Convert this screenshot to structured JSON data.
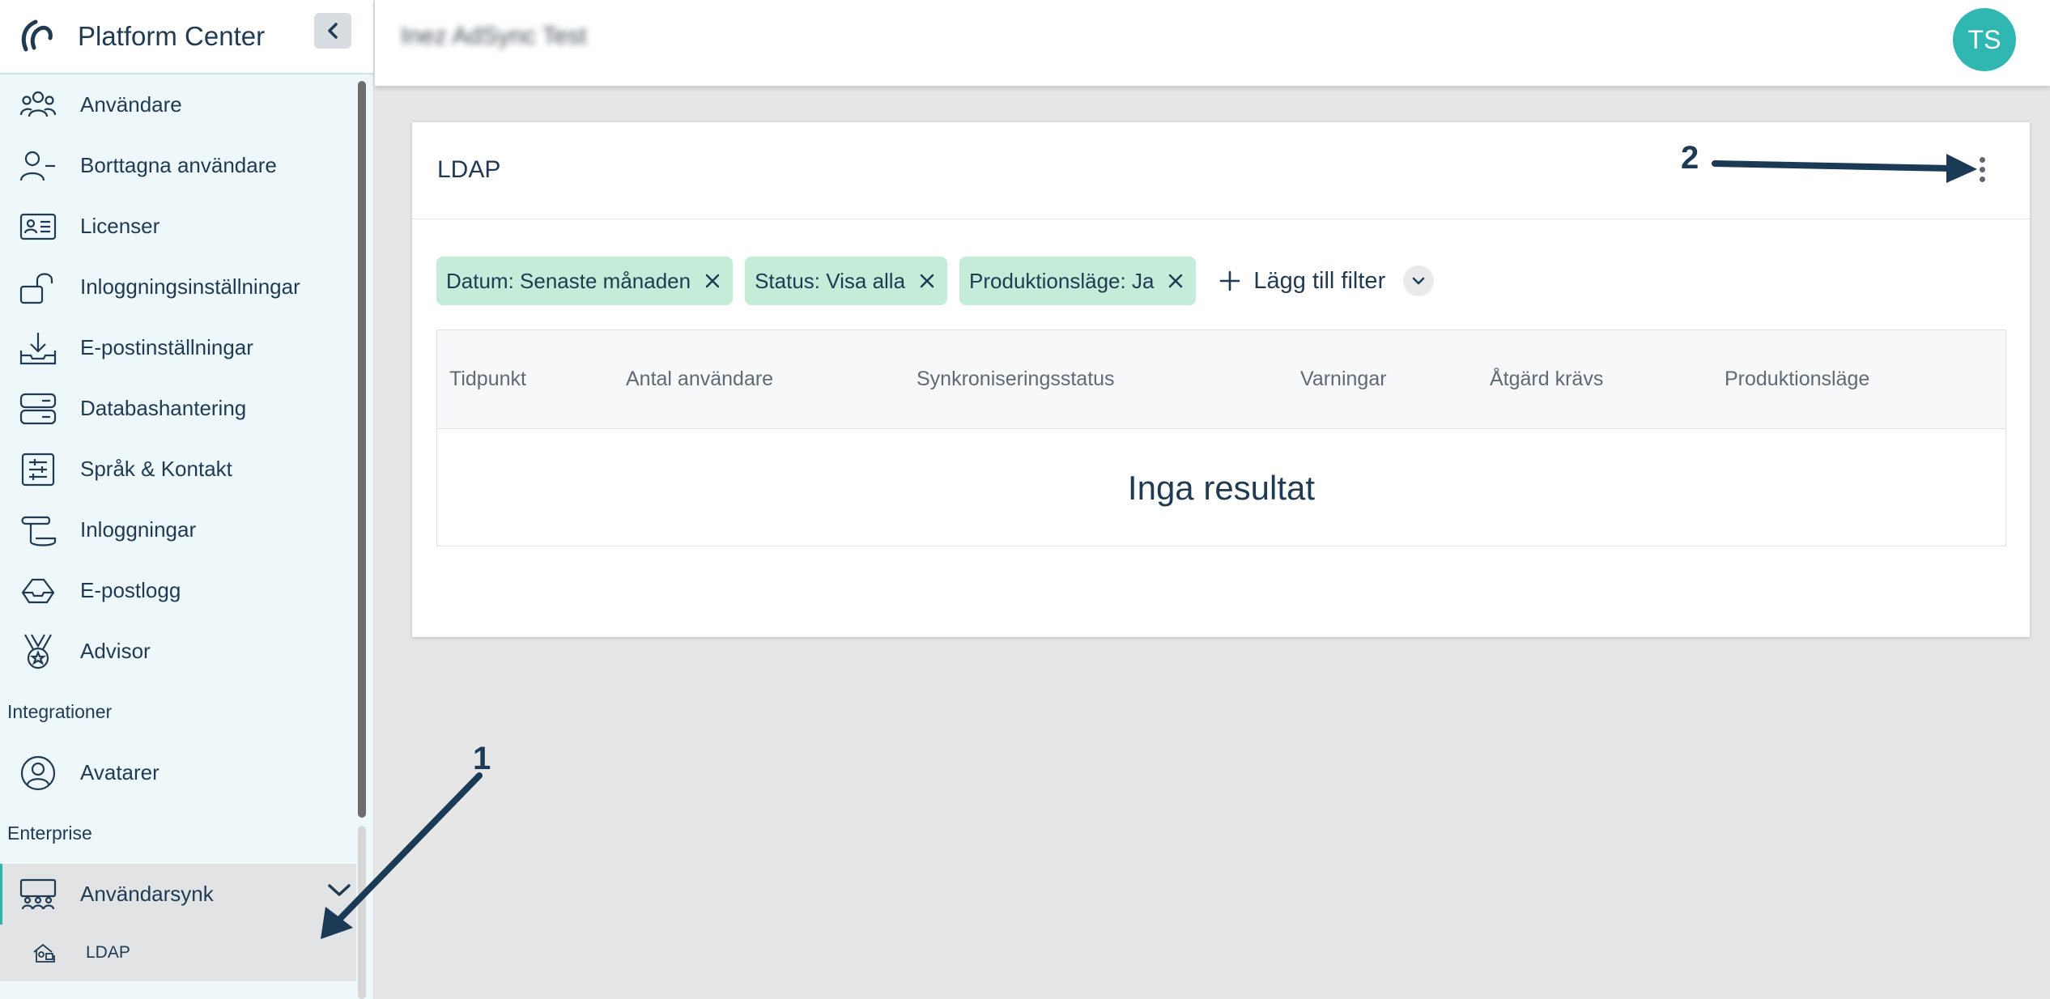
{
  "app": {
    "title": "Platform Center"
  },
  "colors": {
    "accent": "#31b7b1",
    "chip": "#c5ecd9",
    "text": "#1f3a52"
  },
  "sidebar": {
    "items": [
      {
        "label": "Användare",
        "icon": "users-icon"
      },
      {
        "label": "Borttagna användare",
        "icon": "user-minus-icon"
      },
      {
        "label": "Licenser",
        "icon": "id-card-icon"
      },
      {
        "label": "Inloggningsinställningar",
        "icon": "unlock-icon"
      },
      {
        "label": "E-postinställningar",
        "icon": "download-tray-icon"
      },
      {
        "label": "Databashantering",
        "icon": "server-icon"
      },
      {
        "label": "Språk & Kontakt",
        "icon": "sliders-icon"
      },
      {
        "label": "Inloggningar",
        "icon": "scroll-icon"
      },
      {
        "label": "E-postlogg",
        "icon": "envelope-log-icon"
      },
      {
        "label": "Advisor",
        "icon": "medal-icon"
      }
    ],
    "sections": {
      "integrations": "Integrationer",
      "enterprise": "Enterprise"
    },
    "integrations_items": [
      {
        "label": "Avatarer",
        "icon": "user-circle-icon"
      }
    ],
    "enterprise_items": [
      {
        "label": "Användarsynk",
        "icon": "team-icon"
      },
      {
        "label": "LDAP",
        "icon": "ldap-icon"
      }
    ]
  },
  "topbar": {
    "tenant": "Inez AdSync Test",
    "avatar_initials": "TS"
  },
  "card": {
    "title": "LDAP",
    "filters": [
      {
        "label": "Datum: Senaste månaden"
      },
      {
        "label": "Status: Visa alla"
      },
      {
        "label": "Produktionsläge: Ja"
      }
    ],
    "add_filter_label": "Lägg till filter",
    "columns": [
      "Tidpunkt",
      "Antal användare",
      "Synkroniseringsstatus",
      "Varningar",
      "Åtgärd krävs",
      "Produktionsläge"
    ],
    "empty_text": "Inga resultat"
  },
  "annotations": {
    "one": "1",
    "two": "2"
  }
}
